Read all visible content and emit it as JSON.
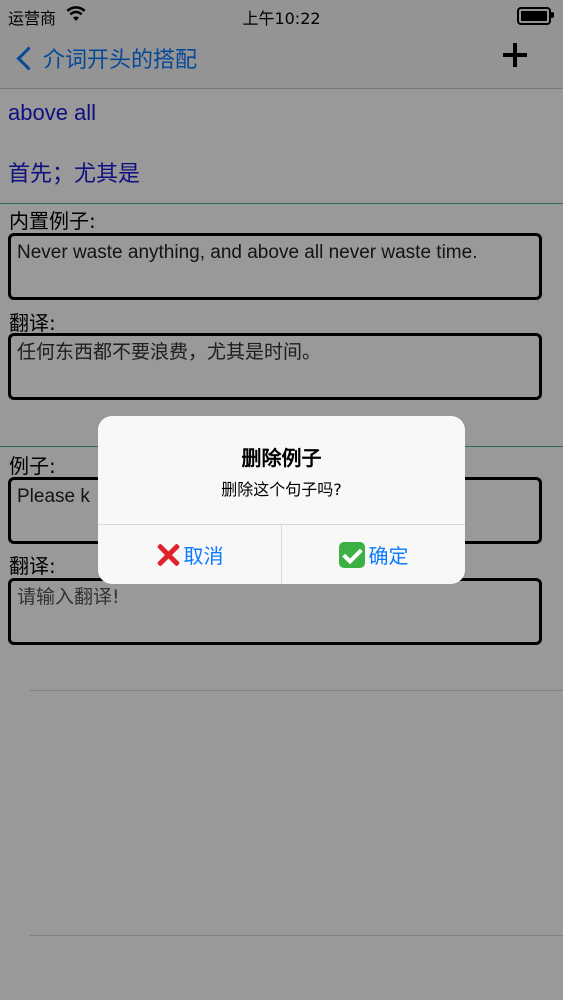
{
  "status_bar": {
    "carrier": "运营商",
    "time": "上午10:22"
  },
  "nav": {
    "back_label": "介词开头的搭配"
  },
  "entry": {
    "phrase": "above all",
    "meaning": "首先；尤其是"
  },
  "builtin_example": {
    "label": "内置例子:",
    "sentence": "Never waste anything, and above all never waste time.",
    "translation_label": "翻译:",
    "translation": "任何东西都不要浪费，尤其是时间。"
  },
  "user_example": {
    "label": "例子:",
    "sentence_visible": "Please k",
    "translation_label": "翻译:",
    "translation_placeholder": "请输入翻译!"
  },
  "alert": {
    "title": "删除例子",
    "message": "删除这个句子吗?",
    "cancel_label": "取消",
    "confirm_label": "确定"
  }
}
